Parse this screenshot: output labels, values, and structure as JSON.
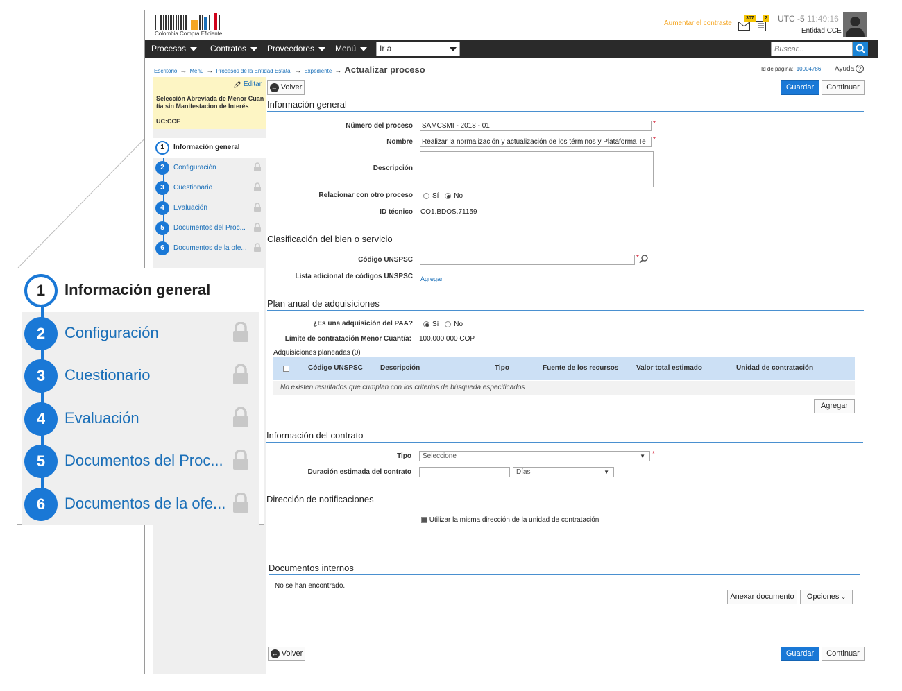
{
  "header": {
    "logo_text": "Colombia Compra Eficiente",
    "contrast_link": "Aumentar el contraste",
    "mail_count": "307",
    "notif_count": "2",
    "timezone": "UTC -5",
    "time": "11:49:16",
    "entity": "Entidad CCE"
  },
  "nav": {
    "items": [
      "Procesos",
      "Contratos",
      "Proveedores",
      "Menú"
    ],
    "goto_value": "Ir a",
    "search_placeholder": "Buscar..."
  },
  "breadcrumb": {
    "items": [
      "Escritorio",
      "Menú",
      "Procesos de la Entidad Estatal",
      "Expediente"
    ],
    "current": "Actualizar proceso",
    "page_id_label": "Id de página::",
    "page_id": "10004786",
    "help": "Ayuda"
  },
  "sidebar": {
    "edit_label": "Editar",
    "process_type": "Selección Abreviada de Menor Cuantía sin Manifestacion de Interés",
    "unit": "UC:CCE",
    "steps": [
      {
        "num": "1",
        "label": "Información general"
      },
      {
        "num": "2",
        "label": "Configuración"
      },
      {
        "num": "3",
        "label": "Cuestionario"
      },
      {
        "num": "4",
        "label": "Evaluación"
      },
      {
        "num": "5",
        "label": "Documentos del Proc..."
      },
      {
        "num": "6",
        "label": "Documentos de la ofe..."
      }
    ]
  },
  "zoom": {
    "steps": [
      {
        "num": "1",
        "label": "Información general"
      },
      {
        "num": "2",
        "label": "Configuración"
      },
      {
        "num": "3",
        "label": "Cuestionario"
      },
      {
        "num": "4",
        "label": "Evaluación"
      },
      {
        "num": "5",
        "label": "Documentos del Proc..."
      },
      {
        "num": "6",
        "label": "Documentos de la ofe..."
      }
    ]
  },
  "actions": {
    "back": "Volver",
    "save": "Guardar",
    "continue": "Continuar"
  },
  "general": {
    "title": "Información general",
    "number_label": "Número del proceso",
    "number_value": "SAMCSMI - 2018 - 01",
    "name_label": "Nombre",
    "name_value": "Realizar la normalización y actualización de los términos y Plataforma Te",
    "desc_label": "Descripción",
    "relate_label": "Relacionar con otro proceso",
    "yes": "Sí",
    "no": "No",
    "tech_id_label": "ID técnico",
    "tech_id_value": "CO1.BDOS.71159"
  },
  "classification": {
    "title": "Clasificación del bien o servicio",
    "unspsc_label": "Código UNSPSC",
    "extra_label": "Lista adicional de códigos UNSPSC",
    "add_link": "Agregar"
  },
  "paa": {
    "title": "Plan anual de adquisiciones",
    "question": "¿Es una adquisición del PAA?",
    "yes": "Sí",
    "no": "No",
    "limit_label": "Límite de contratación Menor Cuantía:",
    "limit_value": "100.000.000 COP",
    "planned": "Adquisiciones planeadas (0)",
    "columns": [
      "Código UNSPSC",
      "Descripción",
      "Tipo",
      "Fuente de los recursos",
      "Valor total estimado",
      "Unidad de contratación"
    ],
    "empty": "No existen resultados que cumplan con los criterios de búsqueda especificados",
    "add_button": "Agregar"
  },
  "contract": {
    "title": "Información del contrato",
    "type_label": "Tipo",
    "type_value": "Seleccione",
    "duration_label": "Duración estimada del contrato",
    "duration_unit": "Días"
  },
  "notifications": {
    "title": "Dirección de notificaciones",
    "same_address": "Utilizar la misma dirección de la unidad de contratación"
  },
  "internal_docs": {
    "title": "Documentos internos",
    "empty": "No se han encontrado.",
    "attach": "Anexar documento",
    "options": "Opciones"
  }
}
